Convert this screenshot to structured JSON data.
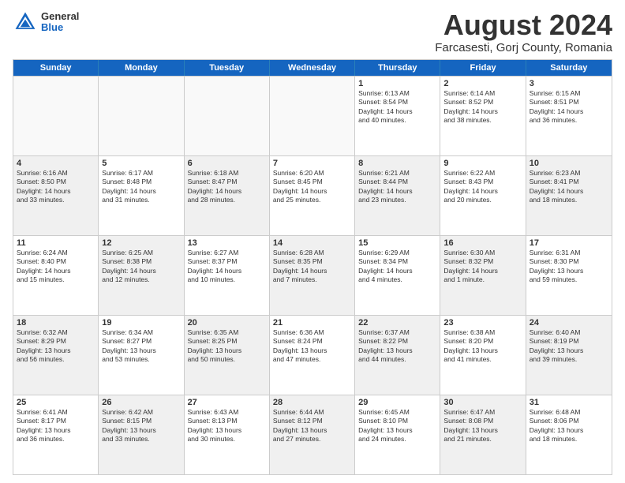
{
  "logo": {
    "general": "General",
    "blue": "Blue"
  },
  "title": "August 2024",
  "location": "Farcasesti, Gorj County, Romania",
  "days_of_week": [
    "Sunday",
    "Monday",
    "Tuesday",
    "Wednesday",
    "Thursday",
    "Friday",
    "Saturday"
  ],
  "weeks": [
    [
      {
        "day": "",
        "info": "",
        "empty": true
      },
      {
        "day": "",
        "info": "",
        "empty": true
      },
      {
        "day": "",
        "info": "",
        "empty": true
      },
      {
        "day": "",
        "info": "",
        "empty": true
      },
      {
        "day": "1",
        "info": "Sunrise: 6:13 AM\nSunset: 8:54 PM\nDaylight: 14 hours\nand 40 minutes."
      },
      {
        "day": "2",
        "info": "Sunrise: 6:14 AM\nSunset: 8:52 PM\nDaylight: 14 hours\nand 38 minutes."
      },
      {
        "day": "3",
        "info": "Sunrise: 6:15 AM\nSunset: 8:51 PM\nDaylight: 14 hours\nand 36 minutes."
      }
    ],
    [
      {
        "day": "4",
        "info": "Sunrise: 6:16 AM\nSunset: 8:50 PM\nDaylight: 14 hours\nand 33 minutes.",
        "shaded": true
      },
      {
        "day": "5",
        "info": "Sunrise: 6:17 AM\nSunset: 8:48 PM\nDaylight: 14 hours\nand 31 minutes."
      },
      {
        "day": "6",
        "info": "Sunrise: 6:18 AM\nSunset: 8:47 PM\nDaylight: 14 hours\nand 28 minutes.",
        "shaded": true
      },
      {
        "day": "7",
        "info": "Sunrise: 6:20 AM\nSunset: 8:45 PM\nDaylight: 14 hours\nand 25 minutes."
      },
      {
        "day": "8",
        "info": "Sunrise: 6:21 AM\nSunset: 8:44 PM\nDaylight: 14 hours\nand 23 minutes.",
        "shaded": true
      },
      {
        "day": "9",
        "info": "Sunrise: 6:22 AM\nSunset: 8:43 PM\nDaylight: 14 hours\nand 20 minutes."
      },
      {
        "day": "10",
        "info": "Sunrise: 6:23 AM\nSunset: 8:41 PM\nDaylight: 14 hours\nand 18 minutes.",
        "shaded": true
      }
    ],
    [
      {
        "day": "11",
        "info": "Sunrise: 6:24 AM\nSunset: 8:40 PM\nDaylight: 14 hours\nand 15 minutes."
      },
      {
        "day": "12",
        "info": "Sunrise: 6:25 AM\nSunset: 8:38 PM\nDaylight: 14 hours\nand 12 minutes.",
        "shaded": true
      },
      {
        "day": "13",
        "info": "Sunrise: 6:27 AM\nSunset: 8:37 PM\nDaylight: 14 hours\nand 10 minutes."
      },
      {
        "day": "14",
        "info": "Sunrise: 6:28 AM\nSunset: 8:35 PM\nDaylight: 14 hours\nand 7 minutes.",
        "shaded": true
      },
      {
        "day": "15",
        "info": "Sunrise: 6:29 AM\nSunset: 8:34 PM\nDaylight: 14 hours\nand 4 minutes."
      },
      {
        "day": "16",
        "info": "Sunrise: 6:30 AM\nSunset: 8:32 PM\nDaylight: 14 hours\nand 1 minute.",
        "shaded": true
      },
      {
        "day": "17",
        "info": "Sunrise: 6:31 AM\nSunset: 8:30 PM\nDaylight: 13 hours\nand 59 minutes."
      }
    ],
    [
      {
        "day": "18",
        "info": "Sunrise: 6:32 AM\nSunset: 8:29 PM\nDaylight: 13 hours\nand 56 minutes.",
        "shaded": true
      },
      {
        "day": "19",
        "info": "Sunrise: 6:34 AM\nSunset: 8:27 PM\nDaylight: 13 hours\nand 53 minutes."
      },
      {
        "day": "20",
        "info": "Sunrise: 6:35 AM\nSunset: 8:25 PM\nDaylight: 13 hours\nand 50 minutes.",
        "shaded": true
      },
      {
        "day": "21",
        "info": "Sunrise: 6:36 AM\nSunset: 8:24 PM\nDaylight: 13 hours\nand 47 minutes."
      },
      {
        "day": "22",
        "info": "Sunrise: 6:37 AM\nSunset: 8:22 PM\nDaylight: 13 hours\nand 44 minutes.",
        "shaded": true
      },
      {
        "day": "23",
        "info": "Sunrise: 6:38 AM\nSunset: 8:20 PM\nDaylight: 13 hours\nand 41 minutes."
      },
      {
        "day": "24",
        "info": "Sunrise: 6:40 AM\nSunset: 8:19 PM\nDaylight: 13 hours\nand 39 minutes.",
        "shaded": true
      }
    ],
    [
      {
        "day": "25",
        "info": "Sunrise: 6:41 AM\nSunset: 8:17 PM\nDaylight: 13 hours\nand 36 minutes."
      },
      {
        "day": "26",
        "info": "Sunrise: 6:42 AM\nSunset: 8:15 PM\nDaylight: 13 hours\nand 33 minutes.",
        "shaded": true
      },
      {
        "day": "27",
        "info": "Sunrise: 6:43 AM\nSunset: 8:13 PM\nDaylight: 13 hours\nand 30 minutes."
      },
      {
        "day": "28",
        "info": "Sunrise: 6:44 AM\nSunset: 8:12 PM\nDaylight: 13 hours\nand 27 minutes.",
        "shaded": true
      },
      {
        "day": "29",
        "info": "Sunrise: 6:45 AM\nSunset: 8:10 PM\nDaylight: 13 hours\nand 24 minutes."
      },
      {
        "day": "30",
        "info": "Sunrise: 6:47 AM\nSunset: 8:08 PM\nDaylight: 13 hours\nand 21 minutes.",
        "shaded": true
      },
      {
        "day": "31",
        "info": "Sunrise: 6:48 AM\nSunset: 8:06 PM\nDaylight: 13 hours\nand 18 minutes."
      }
    ]
  ]
}
